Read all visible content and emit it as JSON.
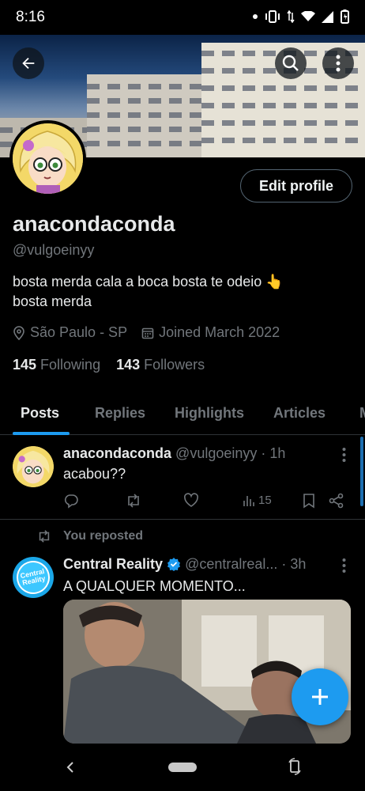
{
  "status_bar": {
    "time": "8:16"
  },
  "profile": {
    "display_name": "anacondaconda",
    "handle": "@vulgoeinyy",
    "bio_line1": "bosta merda cala a boca  bosta te odeio 👆",
    "bio_line2": "bosta merda",
    "location": "São Paulo - SP",
    "joined": "Joined March 2022",
    "following_count": "145",
    "following_label": "Following",
    "followers_count": "143",
    "followers_label": "Followers",
    "edit_button": "Edit profile"
  },
  "tabs": [
    {
      "label": "Posts",
      "active": true
    },
    {
      "label": "Replies",
      "active": false
    },
    {
      "label": "Highlights",
      "active": false
    },
    {
      "label": "Articles",
      "active": false
    },
    {
      "label": "M",
      "active": false
    }
  ],
  "posts": [
    {
      "author": "anacondaconda",
      "handle_time": "@vulgoeinyy · 1h",
      "text": "acabou??",
      "views": "15"
    },
    {
      "repost_label": "You reposted",
      "author": "Central Reality",
      "handle": "@centralreal...",
      "time": "· 3h",
      "text": "A QUALQUER MOMENTO...",
      "avatar_text": "Central Reality"
    }
  ],
  "colors": {
    "accent": "#1d9bf0",
    "muted": "#71767b",
    "text": "#e7e9ea",
    "divider": "#2f3336"
  },
  "icons": [
    "back-arrow-icon",
    "search-icon",
    "more-vertical-icon",
    "location-icon",
    "calendar-icon",
    "reply-icon",
    "repost-icon",
    "like-icon",
    "views-icon",
    "bookmark-icon",
    "share-icon",
    "verified-icon",
    "compose-plus-icon",
    "nav-back-icon",
    "rotate-icon"
  ]
}
